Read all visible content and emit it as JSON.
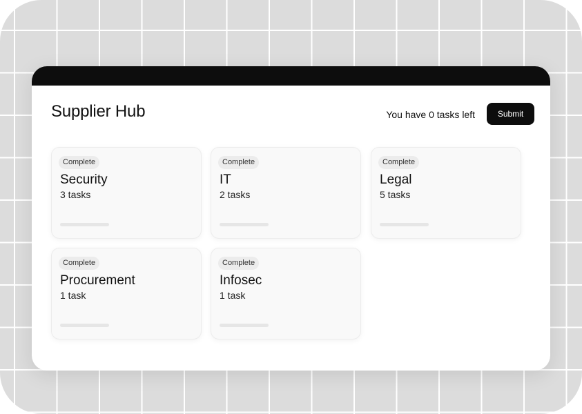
{
  "app": {
    "title": "Supplier Hub",
    "tasks_left_text": "You have 0 tasks left",
    "submit_label": "Submit"
  },
  "colors": {
    "titlebar": "#0d0d0d",
    "button": "#0d0d0d",
    "badge_bg": "#ececec",
    "card_bg": "#f9f9f9"
  },
  "cards": [
    {
      "status": "Complete",
      "name": "Security",
      "count": "3 tasks",
      "progress": 0
    },
    {
      "status": "Complete",
      "name": "IT",
      "count": "2 tasks",
      "progress": 0
    },
    {
      "status": "Complete",
      "name": "Legal",
      "count": "5 tasks",
      "progress": 0
    },
    {
      "status": "Complete",
      "name": "Procurement",
      "count": "1 task",
      "progress": 0
    },
    {
      "status": "Complete",
      "name": "Infosec",
      "count": "1 task",
      "progress": 0
    }
  ]
}
